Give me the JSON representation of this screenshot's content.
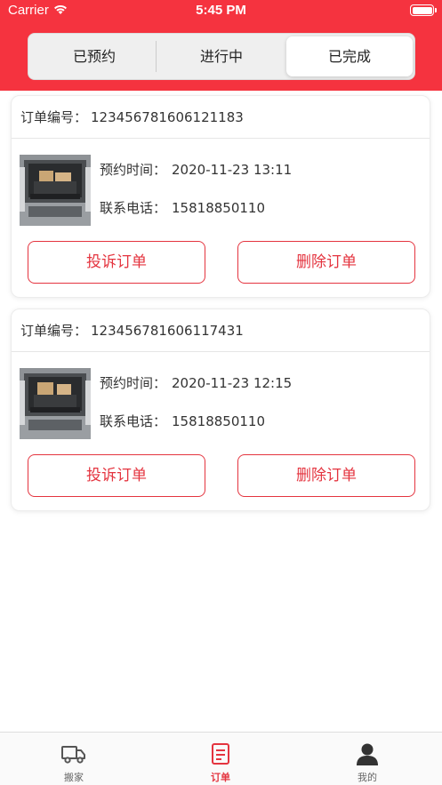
{
  "status_bar": {
    "carrier": "Carrier",
    "time": "5:45 PM"
  },
  "segments": {
    "items": [
      "已预约",
      "进行中",
      "已完成"
    ],
    "selected": "已完成"
  },
  "labels": {
    "order_number": "订单编号：",
    "appointment_time": "预约时间：",
    "phone": "联系电话：",
    "complain_button": "投诉订单",
    "delete_button": "删除订单"
  },
  "orders": [
    {
      "order_number": "123456781606121183",
      "appointment_time": "2020-11-23 13:11",
      "phone": "15818850110",
      "image_icon": "van-cargo-photo"
    },
    {
      "order_number": "123456781606117431",
      "appointment_time": "2020-11-23 12:15",
      "phone": "15818850110",
      "image_icon": "van-cargo-photo"
    }
  ],
  "tabbar": {
    "items": [
      {
        "label": "搬家",
        "icon": "truck-icon"
      },
      {
        "label": "订单",
        "icon": "order-list-icon"
      },
      {
        "label": "我的",
        "icon": "user-icon"
      }
    ],
    "active": "订单"
  },
  "colors": {
    "brand": "#f5333f",
    "accent": "#e4343f",
    "inactive": "#666666"
  }
}
